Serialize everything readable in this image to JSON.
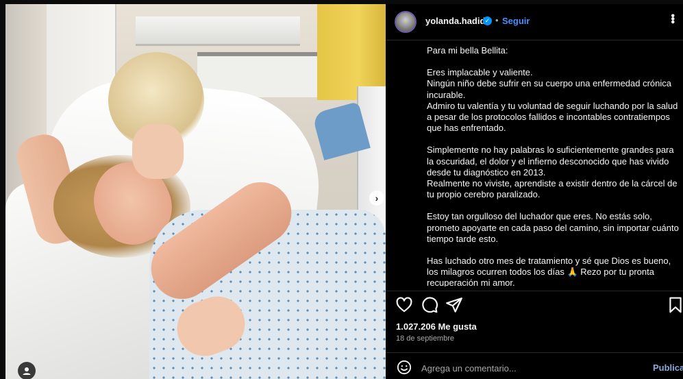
{
  "post": {
    "username": "yolanda.hadid",
    "follow_label": "Seguir",
    "separator": "•",
    "caption_paragraphs": [
      "Para mi bella Bellita:",
      "Eres implacable y valiente.\nNingún niño debe sufrir en su cuerpo una enfermedad crónica incurable.\nAdmiro tu valentía y tu voluntad de seguir luchando por la salud a pesar de los protocolos fallidos e incontables contratiempos que has enfrentado.",
      "Simplemente no hay palabras lo suficientemente grandes para la oscuridad, el dolor y el infierno desconocido que has vivido desde tu diagnóstico en 2013.\nRealmente no viviste, aprendiste a existir dentro de la cárcel de tu propio cerebro paralizado.",
      "Estoy tan orgulloso del luchador que eres. No estás solo, prometo apoyarte en cada paso del camino, sin importar cuánto tiempo tarde esto.",
      "Has luchado otro mes de tratamiento y sé que Dios es bueno, los milagros ocurren todos los días 🙏 Rezo por tu pronta recuperación mi amor."
    ],
    "likes_text": "1.027.206 Me gusta",
    "date_text": "18 de septiembre",
    "comment_placeholder": "Agrega un comentario...",
    "publish_label": "Publicar"
  },
  "icons": {
    "verified": "verified-badge-icon",
    "more": "more-options-icon",
    "like": "heart-icon",
    "comment": "comment-bubble-icon",
    "share": "paper-plane-icon",
    "save": "bookmark-icon",
    "emoji": "emoji-smile-icon",
    "next": "chevron-right-icon",
    "tag": "user-tag-icon"
  },
  "colors": {
    "background": "#000000",
    "text": "#f5f5f5",
    "muted": "#a8a8a8",
    "link": "#4a90ff"
  }
}
